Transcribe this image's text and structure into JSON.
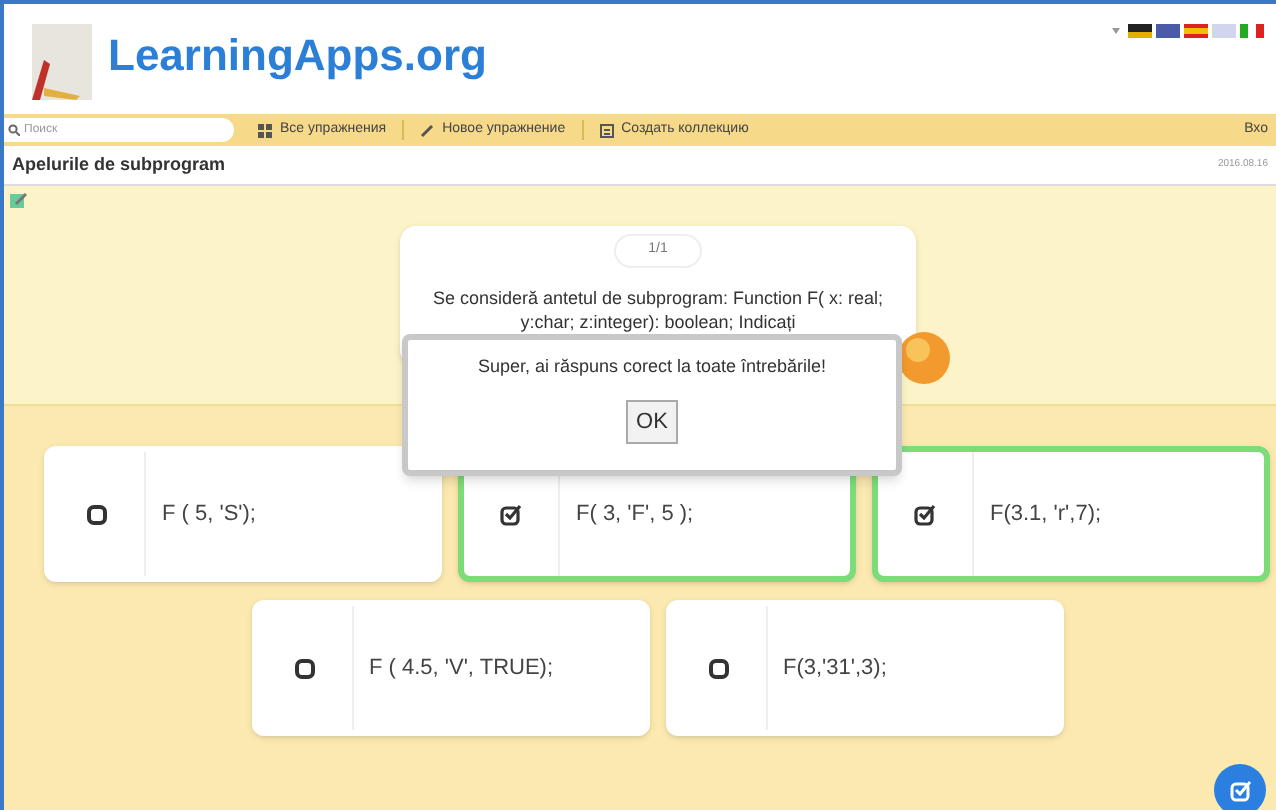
{
  "header": {
    "logo": "LearningApps.org"
  },
  "toolbar": {
    "search": {
      "placeholder": "Поиск"
    },
    "items": [
      "Все упражнения",
      "Новое упражнение",
      "Создать коллекцию"
    ],
    "login": "Вхо"
  },
  "app": {
    "title": "Apelurile de subprogram",
    "date": "2016.08.16"
  },
  "question": {
    "counter": "1/1",
    "text": "Se consideră antetul de subprogram: Function F( x: real; y:char; z:integer): boolean; Indicați"
  },
  "options": [
    {
      "text": "F ( 5, 'S');",
      "selected": false
    },
    {
      "text": "F( 3, 'F', 5 );",
      "selected": true
    },
    {
      "text": "F(3.1, 'r',7);",
      "selected": true
    },
    {
      "text": "F ( 4.5, 'V', TRUE);",
      "selected": false
    },
    {
      "text": "F(3,'31',3);",
      "selected": false
    }
  ],
  "dialog": {
    "message": "Super, ai răspuns corect la toate întrebările!",
    "button": "OK"
  }
}
